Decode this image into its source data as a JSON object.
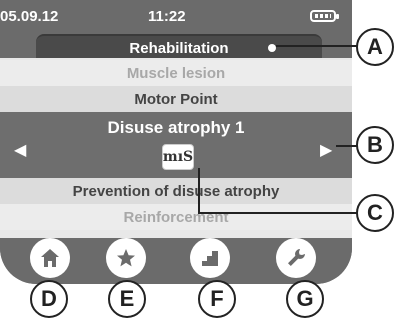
{
  "status": {
    "date": "05.09.12",
    "time": "11:22"
  },
  "header": {
    "title": "Rehabilitation"
  },
  "list": {
    "items": [
      "Muscle lesion",
      "Motor Point",
      "Disuse atrophy 1",
      "Prevention of disuse atrophy",
      "Reinforcement"
    ],
    "selected_index": 2,
    "badge": "mıS"
  },
  "softkeys": [
    {
      "icon": "home-icon"
    },
    {
      "icon": "star-icon"
    },
    {
      "icon": "stairs-icon"
    },
    {
      "icon": "wrench-icon"
    }
  ],
  "callouts": [
    "A",
    "B",
    "C",
    "D",
    "E",
    "F",
    "G"
  ],
  "colors": {
    "frame": "#6b6b6b",
    "title_tab": "#4a4a4a",
    "selected_row": "#6e6e6e"
  }
}
